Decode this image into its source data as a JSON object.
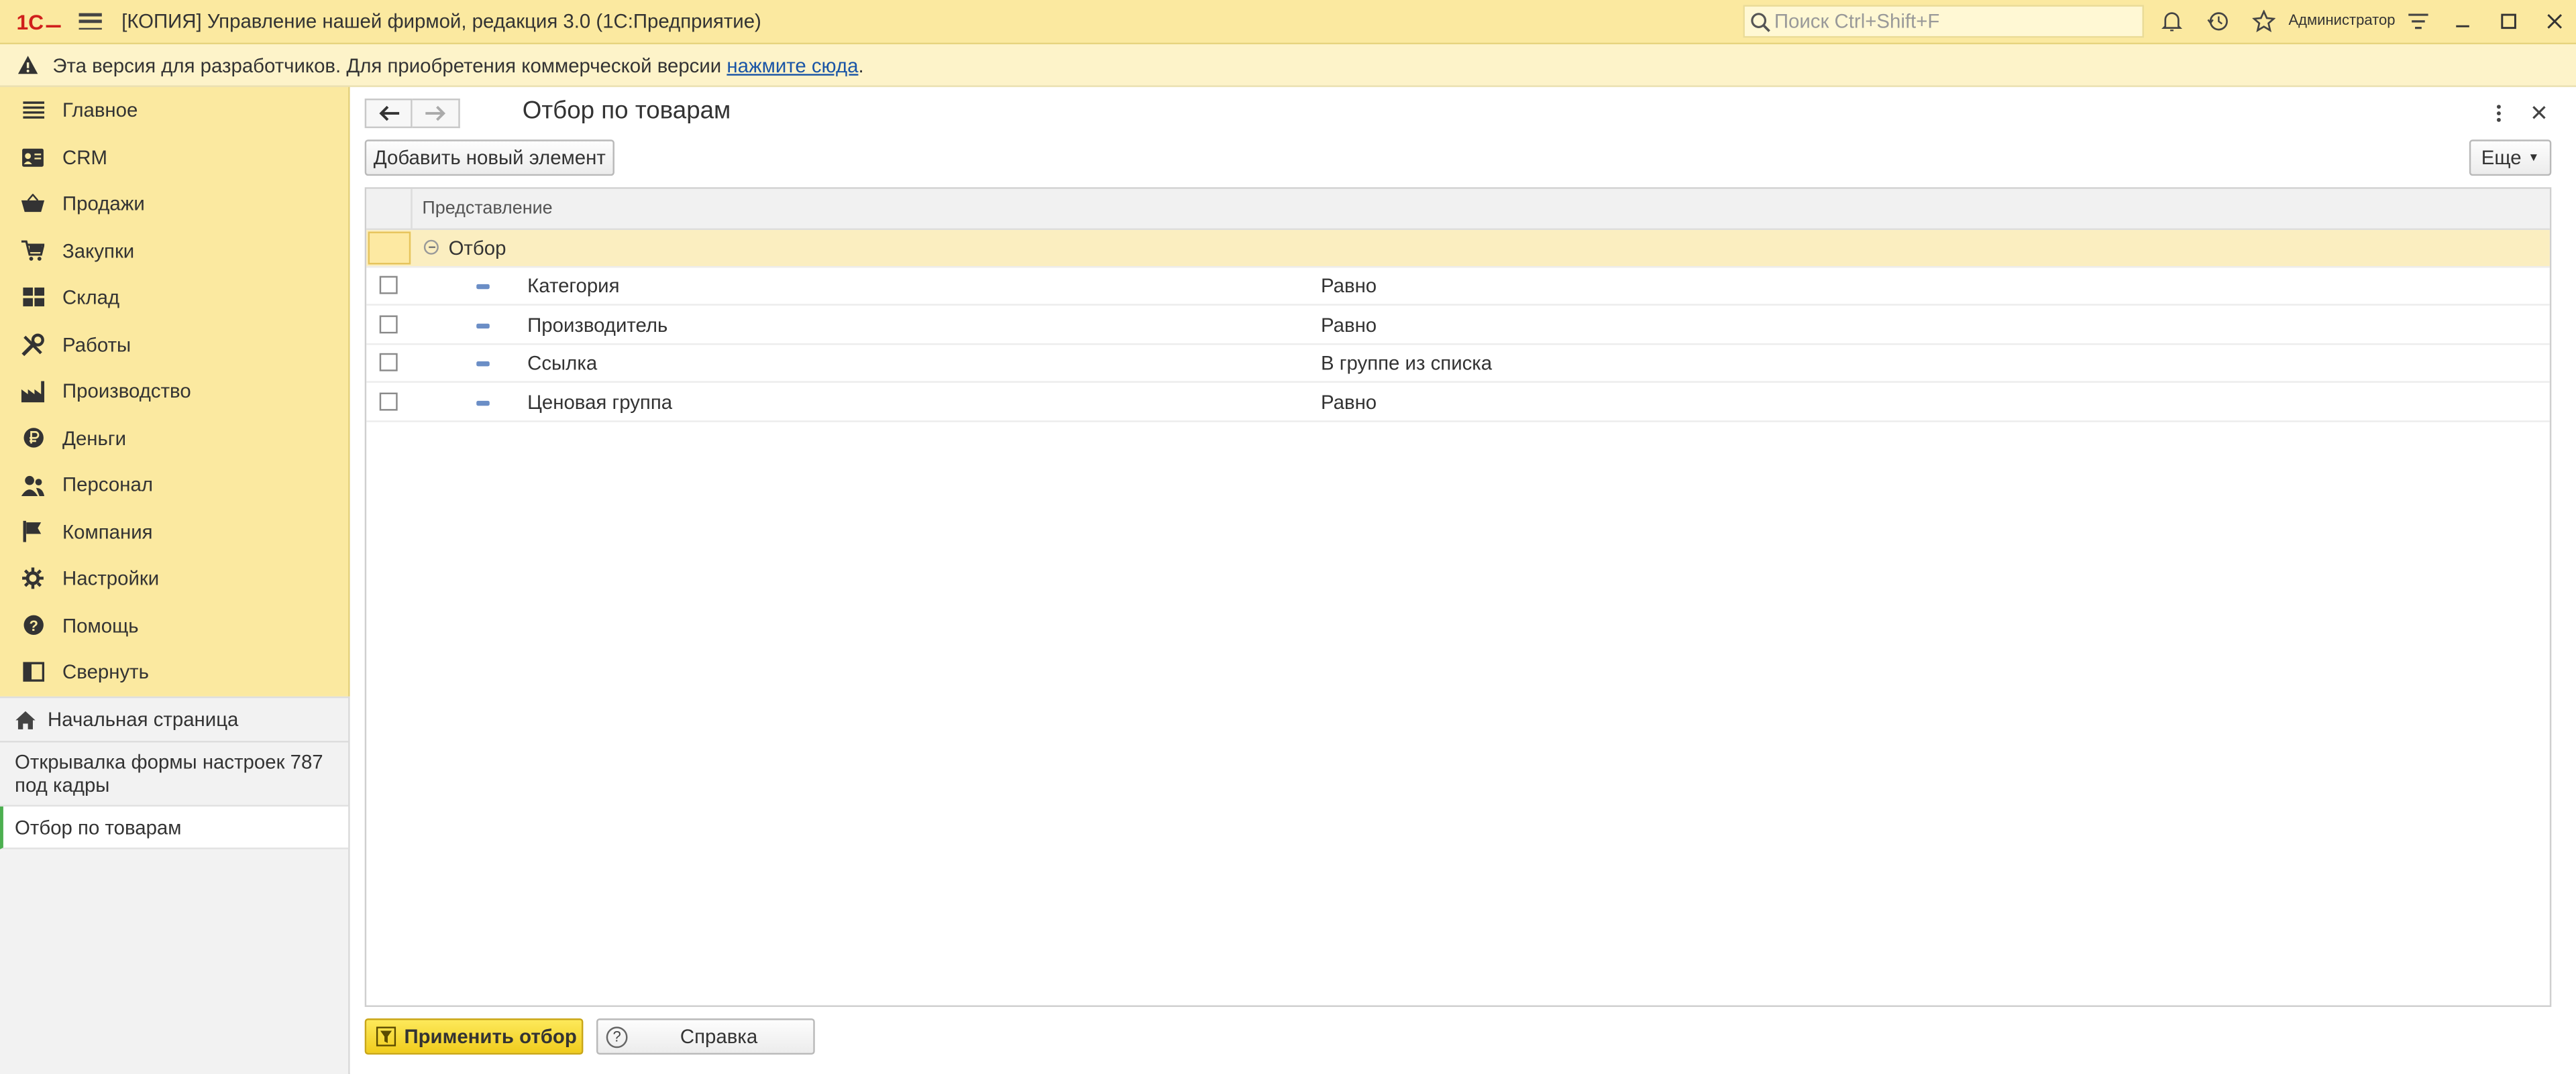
{
  "app": {
    "title": "[КОПИЯ] Управление нашей фирмой, редакция 3.0  (1С:Предприятие)",
    "logo_text": "1С",
    "search_placeholder": "Поиск Ctrl+Shift+F",
    "user": "Администратор"
  },
  "banner": {
    "text": "Эта версия для разработчиков. Для приобретения коммерческой версии ",
    "link": "нажмите сюда",
    "tail": "."
  },
  "sidebar": {
    "items": [
      {
        "label": "Главное",
        "icon": "menu-lines-icon"
      },
      {
        "label": "CRM",
        "icon": "contact-card-icon"
      },
      {
        "label": "Продажи",
        "icon": "basket-icon"
      },
      {
        "label": "Закупки",
        "icon": "cart-icon"
      },
      {
        "label": "Склад",
        "icon": "warehouse-grid-icon"
      },
      {
        "label": "Работы",
        "icon": "tools-icon"
      },
      {
        "label": "Производство",
        "icon": "factory-icon"
      },
      {
        "label": "Деньги",
        "icon": "ruble-coin-icon"
      },
      {
        "label": "Персонал",
        "icon": "people-icon"
      },
      {
        "label": "Компания",
        "icon": "flag-icon"
      },
      {
        "label": "Настройки",
        "icon": "gear-icon"
      },
      {
        "label": "Помощь",
        "icon": "question-icon"
      },
      {
        "label": "Свернуть",
        "icon": "collapse-panel-icon"
      }
    ]
  },
  "open_windows": {
    "home": "Начальная страница",
    "items": [
      {
        "label": "Открывалка формы настроек 787 под кадры"
      },
      {
        "label": "Отбор по товарам"
      }
    ]
  },
  "form": {
    "title": "Отбор по товарам",
    "add_button": "Добавить новый элемент",
    "more_button": "Еще",
    "column_header": "Представление",
    "group_label": "Отбор",
    "rows": [
      {
        "name": "Категория",
        "condition": "Равно"
      },
      {
        "name": "Производитель",
        "condition": "Равно"
      },
      {
        "name": "Ссылка",
        "condition": "В группе из списка"
      },
      {
        "name": "Ценовая группа",
        "condition": "Равно"
      }
    ],
    "apply_button": "Применить отбор",
    "help_button": "Справка"
  }
}
